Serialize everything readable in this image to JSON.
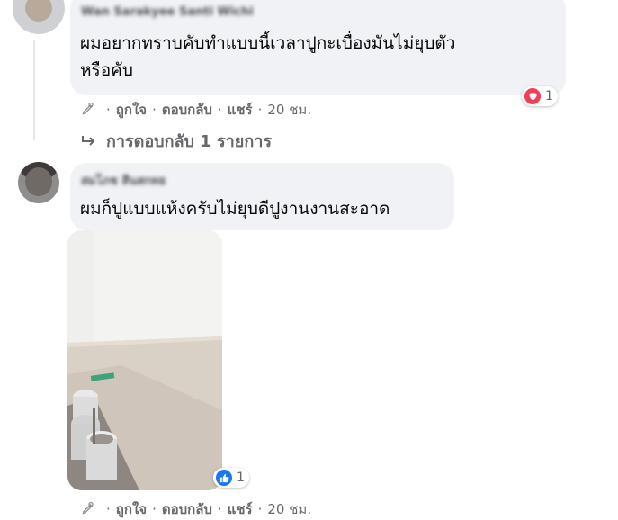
{
  "comment1": {
    "author": "Wan Sarakyee Santi Wichi",
    "lines": [
      "ผมอยากทราบคับทำแบบนี้เวลาปูกะเบื่องมันไม่ยุบตัว",
      "หรือคับ"
    ],
    "reaction": {
      "icon": "heart-icon",
      "count": "1"
    },
    "actions": {
      "like": "ถูกใจ",
      "reply": "ตอบกลับ",
      "share": "แชร์",
      "time": "20 ชม."
    }
  },
  "replies_link": "การตอบกลับ 1 รายการ",
  "comment2": {
    "author": "สมโภช สีนสกทธ",
    "text": "ผมก็ปูแบบแห้งครับไม่ยุบดีปูงานงานสะอาด",
    "reaction": {
      "icon": "like-icon",
      "count": "1"
    },
    "actions": {
      "like": "ถูกใจ",
      "reply": "ตอบกลับ",
      "share": "แชร์",
      "time": "20 ชม."
    }
  },
  "colors": {
    "bubble": "#f0f2f5",
    "meta_text": "#65676b",
    "like_blue": "#1877f2",
    "love_red": "#f33e58"
  }
}
